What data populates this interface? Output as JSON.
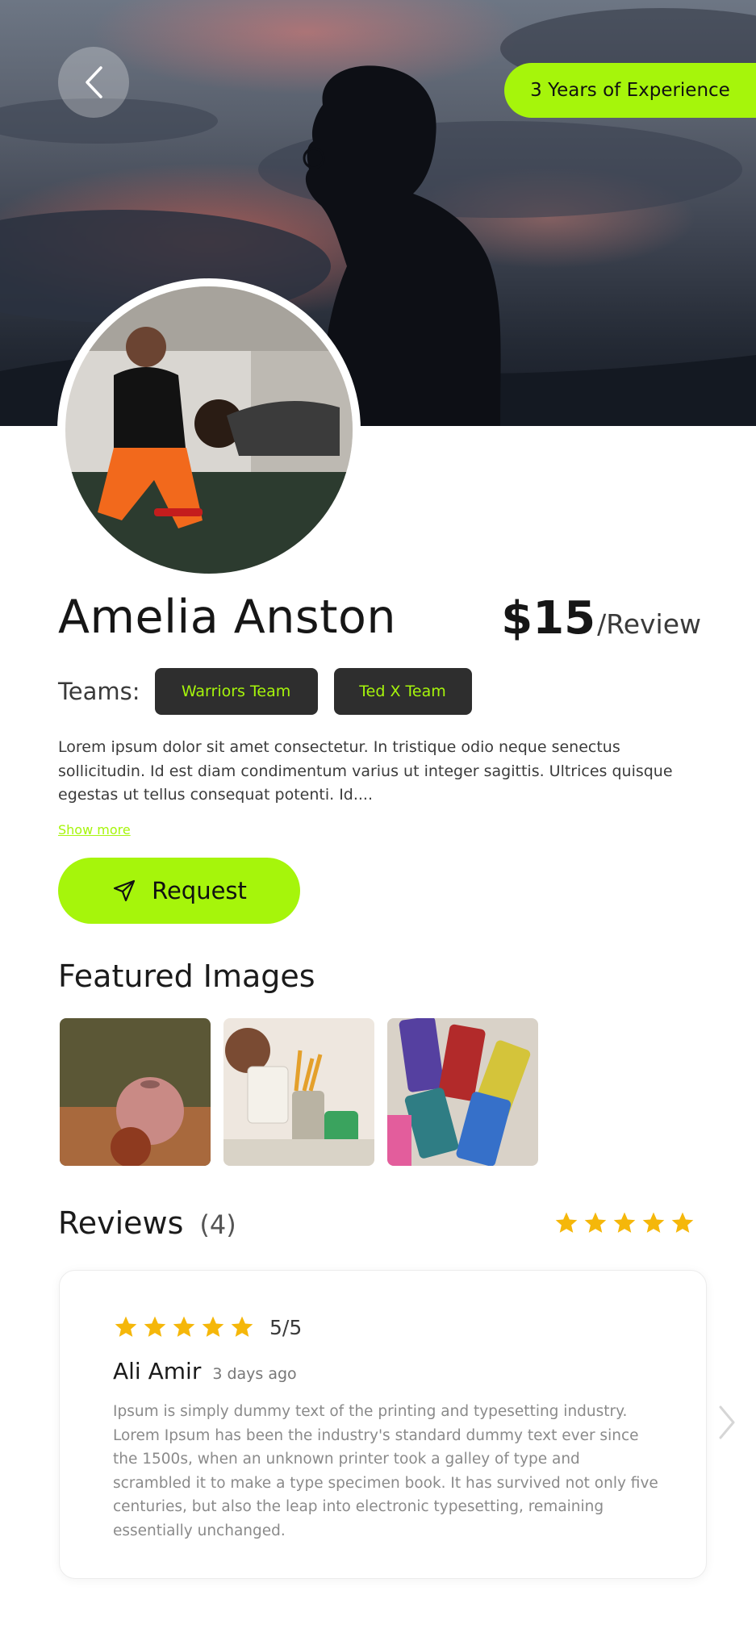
{
  "header": {
    "experience_badge": "3 Years of Experience"
  },
  "profile": {
    "name": "Amelia Anston",
    "price": "$15",
    "price_unit": "/Review",
    "teams_label": "Teams:",
    "teams": [
      "Warriors Team",
      "Ted X Team"
    ],
    "bio": "Lorem ipsum dolor sit amet consectetur. In tristique odio neque senectus sollicitudin. Id est diam condimentum varius ut integer sagittis. Ultrices quisque egestas ut tellus consequat potenti. Id....",
    "show_more": "Show more",
    "request_label": "Request"
  },
  "featured": {
    "title": "Featured Images"
  },
  "reviews": {
    "title": "Reviews",
    "count": "(4)",
    "overall_stars": 5,
    "items": [
      {
        "stars": 5,
        "score": "5/5",
        "name": "Ali Amir",
        "time": "3 days ago",
        "text": "Ipsum is simply dummy text of the printing and typesetting industry. Lorem Ipsum has been the industry's standard dummy text ever since the 1500s, when an unknown printer took a galley of type and scrambled it to make a type specimen book. It has survived not only five centuries, but also the leap into electronic typesetting, remaining essentially unchanged."
      }
    ]
  },
  "colors": {
    "accent": "#a6f50b",
    "chip_bg": "#2e2e2e",
    "star": "#f5b70a"
  },
  "icons": [
    "chevron-left-icon",
    "send-icon",
    "star-icon",
    "chevron-right-icon"
  ]
}
